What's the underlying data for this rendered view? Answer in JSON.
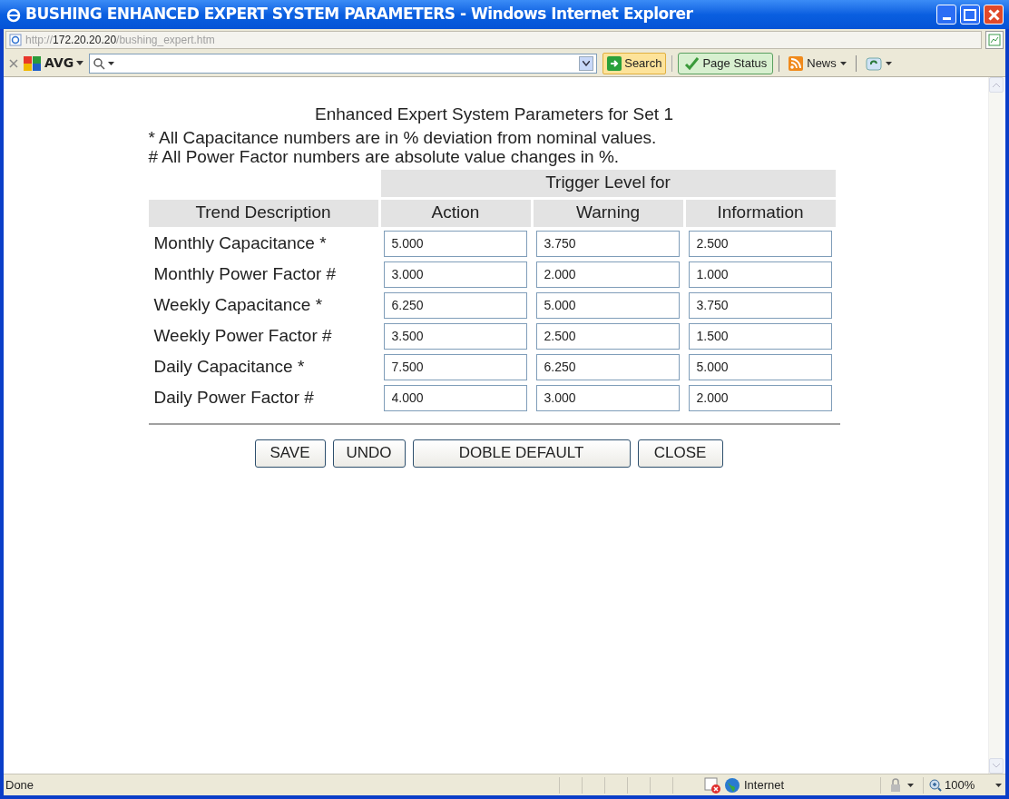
{
  "window": {
    "title": "BUSHING ENHANCED EXPERT SYSTEM PARAMETERS - Windows Internet Explorer"
  },
  "address_bar": {
    "scheme": "http://",
    "host": "172.20.20.20",
    "path": "/bushing_expert.htm"
  },
  "toolbar": {
    "brand": "AVG",
    "search_button": "Search",
    "page_status_button": "Page Status",
    "news_button": "News"
  },
  "page": {
    "heading": "Enhanced Expert System Parameters for Set 1",
    "notes": [
      "* All Capacitance numbers are in % deviation from nominal values.",
      "# All Power Factor numbers are absolute value changes in %."
    ],
    "table": {
      "group_header": "Trigger Level for",
      "columns": [
        "Trend Description",
        "Action",
        "Warning",
        "Information"
      ],
      "rows": [
        {
          "label": "Monthly Capacitance *",
          "values": [
            "5.000",
            "3.750",
            "2.500"
          ]
        },
        {
          "label": "Monthly Power Factor #",
          "values": [
            "3.000",
            "2.000",
            "1.000"
          ]
        },
        {
          "label": "Weekly Capacitance *",
          "values": [
            "6.250",
            "5.000",
            "3.750"
          ]
        },
        {
          "label": "Weekly Power Factor #",
          "values": [
            "3.500",
            "2.500",
            "1.500"
          ]
        },
        {
          "label": "Daily Capacitance *",
          "values": [
            "7.500",
            "6.250",
            "5.000"
          ]
        },
        {
          "label": "Daily Power Factor #",
          "values": [
            "4.000",
            "3.000",
            "2.000"
          ]
        }
      ]
    },
    "buttons": [
      "SAVE",
      "UNDO",
      "DOBLE DEFAULT",
      "CLOSE"
    ]
  },
  "status_bar": {
    "status": "Done",
    "zone": "Internet",
    "zoom": "100%"
  }
}
